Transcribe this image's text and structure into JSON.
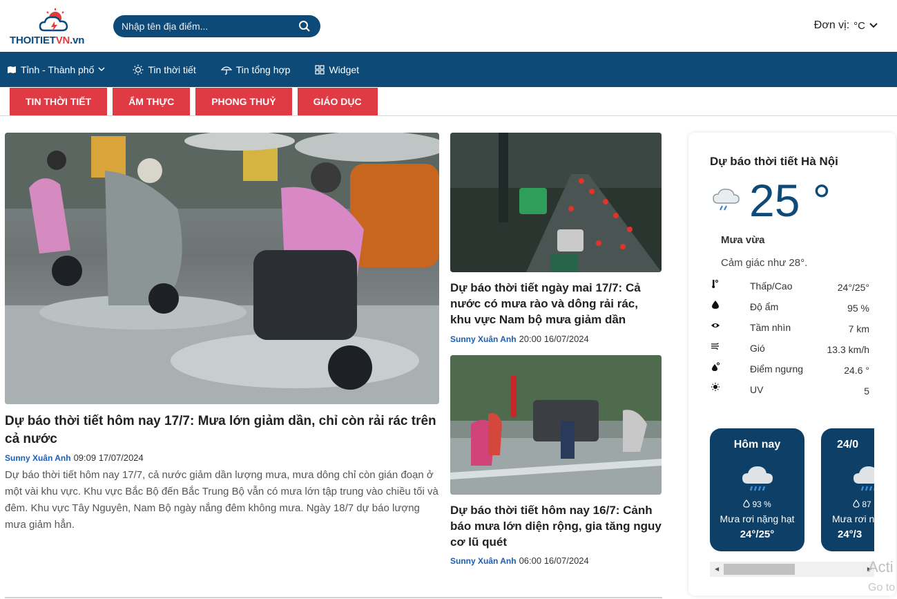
{
  "logo": {
    "part1": "THOITIET",
    "part2": "VN",
    "part3": ".vn"
  },
  "search": {
    "placeholder": "Nhập tên địa điểm..."
  },
  "unit": {
    "label": "Đơn vị:",
    "value": "°C"
  },
  "nav": [
    {
      "label": "Tỉnh - Thành phố",
      "icon": "map-icon"
    },
    {
      "label": "Tin thời tiết",
      "icon": "sun-icon"
    },
    {
      "label": "Tin tổng hợp",
      "icon": "umbrella-icon"
    },
    {
      "label": "Widget",
      "icon": "grid-icon"
    }
  ],
  "categories": [
    "TIN THỜI TIẾT",
    "ẨM THỰC",
    "PHONG THUỶ",
    "GIÁO DỤC"
  ],
  "main_article": {
    "title": "Dự báo thời tiết hôm nay 17/7: Mưa lớn giảm dần, chỉ còn rải rác trên cả nước",
    "author": "Sunny Xuân Anh",
    "time": "09:09 17/07/2024",
    "excerpt": "Dự báo thời tiết hôm nay 17/7, cả nước giảm dần lượng mưa, mưa dông chỉ còn gián đoạn ở một vài khu vực. Khu vực Bắc Bộ đến Bắc Trung Bộ vẫn có mưa lớn tập trung vào chiều tối và đêm. Khu vực Tây Nguyên, Nam Bộ ngày nắng đêm không mưa. Ngày 18/7 dự báo lượng mưa giảm hẳn."
  },
  "side_articles": [
    {
      "title": "Dự báo thời tiết ngày mai 17/7: Cả nước có mưa rào và dông rải rác, khu vực Nam bộ mưa giảm dần",
      "author": "Sunny Xuân Anh",
      "time": "20:00 16/07/2024"
    },
    {
      "title": "Dự báo thời tiết hôm nay 16/7: Cảnh báo mưa lớn diện rộng, gia tăng nguy cơ lũ quét",
      "author": "Sunny Xuân Anh",
      "time": "06:00 16/07/2024"
    }
  ],
  "weather": {
    "title": "Dự báo thời tiết Hà Nội",
    "temp": "25 °",
    "condition": "Mưa vừa",
    "feels_like": "Cảm giác như 28°.",
    "details": [
      {
        "icon": "thermometer-icon",
        "label": "Thấp/Cao",
        "value": "24°/25°"
      },
      {
        "icon": "droplet-icon",
        "label": "Độ ẩm",
        "value": "95 %"
      },
      {
        "icon": "eye-icon",
        "label": "Tầm nhìn",
        "value": "7 km"
      },
      {
        "icon": "wind-icon",
        "label": "Gió",
        "value": "13.3 km/h"
      },
      {
        "icon": "dewpoint-icon",
        "label": "Điểm ngưng",
        "value": "24.6 °"
      },
      {
        "icon": "uv-sun-icon",
        "label": "UV",
        "value": "5"
      }
    ],
    "forecast": [
      {
        "title": "Hôm nay",
        "humidity": "93 %",
        "desc": "Mưa rơi nặng hạt",
        "temp": "24°/25°"
      },
      {
        "title": "24/0",
        "humidity": "87",
        "desc": "Mưa rơi n",
        "temp": "24°/3"
      }
    ]
  },
  "overlay": {
    "line1": "Acti",
    "line2": "Go to"
  },
  "colors": {
    "navy": "#0e4a78",
    "red": "#e03a45",
    "author_blue": "#1a5fb4"
  }
}
